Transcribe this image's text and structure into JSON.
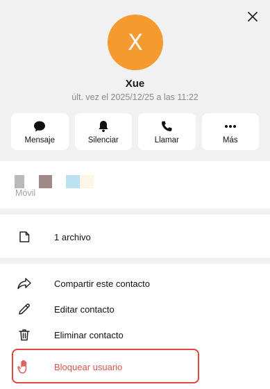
{
  "contact": {
    "avatar_letter": "X",
    "avatar_color": "#f59a2e",
    "name": "Xue",
    "last_seen": "últ. vez el 2025/12/25 a las 11:22"
  },
  "actions": [
    {
      "label": "Mensaje",
      "icon": "message-icon"
    },
    {
      "label": "Silenciar",
      "icon": "bell-icon"
    },
    {
      "label": "Llamar",
      "icon": "phone-icon"
    },
    {
      "label": "Más",
      "icon": "more-icon"
    }
  ],
  "phone": {
    "label": "Móvil",
    "redacted_colors": [
      "#b9b9b9",
      "#a08a88",
      "#bde1f0",
      "#fdf6e6"
    ]
  },
  "files": {
    "label": "1 archivo",
    "icon": "file-icon"
  },
  "menu": [
    {
      "label": "Compartir este contacto",
      "icon": "share-icon"
    },
    {
      "label": "Editar contacto",
      "icon": "pencil-icon"
    },
    {
      "label": "Eliminar contacto",
      "icon": "trash-icon"
    },
    {
      "label": "Bloquear usuario",
      "icon": "hand-icon",
      "color": "#d9534f"
    }
  ],
  "colors": {
    "header_bg": "#f1f1f1",
    "danger": "#d9534f",
    "highlight_border": "#e0463c"
  }
}
